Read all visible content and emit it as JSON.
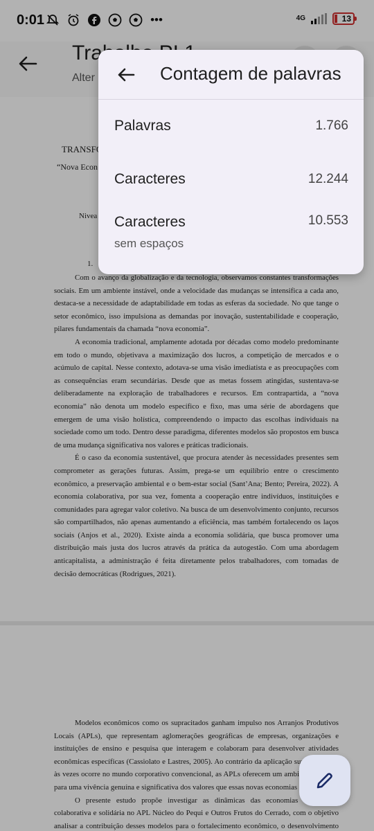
{
  "status_bar": {
    "time": "0:01",
    "network": "4G",
    "battery": "13",
    "more": "•••"
  },
  "app_bar": {
    "title": "Trabalho PI 1",
    "subtitle": "Alter"
  },
  "document": {
    "title_line_1": "TRANSFO",
    "title_line_2": "“Nova Econ",
    "author_fragment": "Nivea",
    "section_number": "1.",
    "page1_paragraphs": [
      "Com o avanço da globalização e da tecnologia, observamos constantes transformações sociais. Em um ambiente instável, onde a velocidade das mudanças se intensifica a cada ano, destaca-se a necessidade de adaptabilidade em todas as esferas da sociedade. No que tange o setor econômico, isso impulsiona as demandas por inovação, sustentabilidade e cooperação, pilares fundamentais da chamada “nova economia”.",
      "A economia tradicional, amplamente adotada por décadas como modelo predominante em todo o mundo, objetivava a maximização dos lucros, a competição de mercados e o acúmulo de capital. Nesse contexto, adotava-se uma visão imediatista e as preocupações com as consequências eram secundárias. Desde que as metas fossem atingidas, sustentava-se deliberadamente na exploração de trabalhadores e recursos. Em contrapartida, a “nova economia” não denota um modelo específico e fixo, mas uma série de abordagens que emergem de uma visão holística, compreendendo o impacto das escolhas individuais na sociedade como um todo. Dentro desse paradigma, diferentes modelos são propostos em busca de uma mudança significativa nos valores e práticas tradicionais.",
      "É o caso da economia sustentável, que procura atender às necessidades presentes sem comprometer as gerações futuras. Assim, prega-se um equilíbrio entre o crescimento econômico, a preservação ambiental e o bem-estar social (Sant’Ana; Bento; Pereira, 2022). A economia colaborativa, por sua vez, fomenta a cooperação entre indivíduos, instituições e comunidades para agregar valor coletivo. Na busca de um desenvolvimento conjunto, recursos são compartilhados, não apenas aumentando a eficiência, mas também fortalecendo os laços sociais (Anjos et al., 2020). Existe ainda a economia solidária, que busca promover uma distribuição mais justa dos lucros através da prática da autogestão. Com uma abordagem anticapitalista, a administração é feita diretamente pelos trabalhadores, com tomadas de decisão democráticas (Rodrigues, 2021)."
    ],
    "page2_paragraphs": [
      "Modelos econômicos como os supracitados ganham impulso nos Arranjos Produtivos Locais (APLs), que representam aglomerações geográficas de empresas, organizações e instituições de ensino e pesquisa que interagem e colaboram para desenvolver atividades econômicas específicas (Cassiolato e Lastres, 2005). Ao contrário da aplicação superficial que às vezes ocorre no mundo corporativo convencional, as APLs oferecem um ambiente propício para uma vivência genuína e significativa dos valores que essas novas economias carregam.",
      "O presente estudo propõe investigar as dinâmicas das economias sustentável, colaborativa e solidária no APL Núcleo do Pequi e Outros Frutos do Cerrado, com o objetivo analisar a contribuição desses modelos para o fortalecimento econômico, o desenvolvimento sustentável, e a preservação sociocultural da região. Para atingir tal fim, será conduzida uma pesquisa bibliográfica aprofundada sobre o tema norteador, aliada à análise de dados fornecidos pela diretoria do Núcleo do Pequi."
    ]
  },
  "dialog": {
    "title": "Contagem de palavras",
    "stats": [
      {
        "label": "Palavras",
        "value": "1.766"
      },
      {
        "label": "Caracteres",
        "value": "12.244"
      },
      {
        "label": "Caracteres",
        "sublabel": "sem espaços",
        "value": "10.553"
      }
    ]
  }
}
